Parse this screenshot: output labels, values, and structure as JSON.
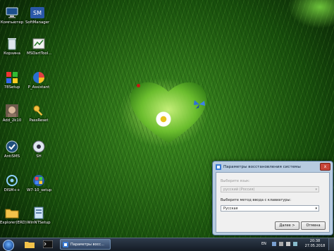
{
  "desktop": {
    "icons": [
      {
        "label": "Компьютер",
        "icon": "computer-icon"
      },
      {
        "label": "SoftManager",
        "icon": "softmanager-icon"
      },
      {
        "label": "Корзина",
        "icon": "recycle-bin-icon"
      },
      {
        "label": "MSDartTool...",
        "icon": "msdart-icon"
      },
      {
        "label": "78Setup",
        "icon": "setup-icon"
      },
      {
        "label": "P_Assistant",
        "icon": "partition-assistant-icon"
      },
      {
        "label": "Add_2k10",
        "icon": "add2k10-icon"
      },
      {
        "label": "PassReset",
        "icon": "passreset-icon"
      },
      {
        "label": "AntiSMS",
        "icon": "antisms-icon"
      },
      {
        "label": "SH",
        "icon": "sh-icon"
      },
      {
        "label": "DISM++",
        "icon": "dism-icon"
      },
      {
        "label": "W7-10_setup",
        "icon": "w7setup-icon"
      },
      {
        "label": "Explorer(ERD)",
        "icon": "explorer-erd-icon"
      },
      {
        "label": "WinNTSetup",
        "icon": "winntsetup-icon"
      }
    ]
  },
  "dialog": {
    "title": "Параметры восстановления системы",
    "language_label": "Выберите язык:",
    "language_value": "русский (Россия)",
    "keyboard_label": "Выберите метод ввода с клавиатуры:",
    "keyboard_value": "Русская",
    "next_button": "Далее >",
    "cancel_button": "Отмена",
    "close_glyph": "x"
  },
  "taskbar": {
    "task_label": "Параметры восс...",
    "language": "EN",
    "time": "20:38",
    "date": "27.05.2018"
  }
}
